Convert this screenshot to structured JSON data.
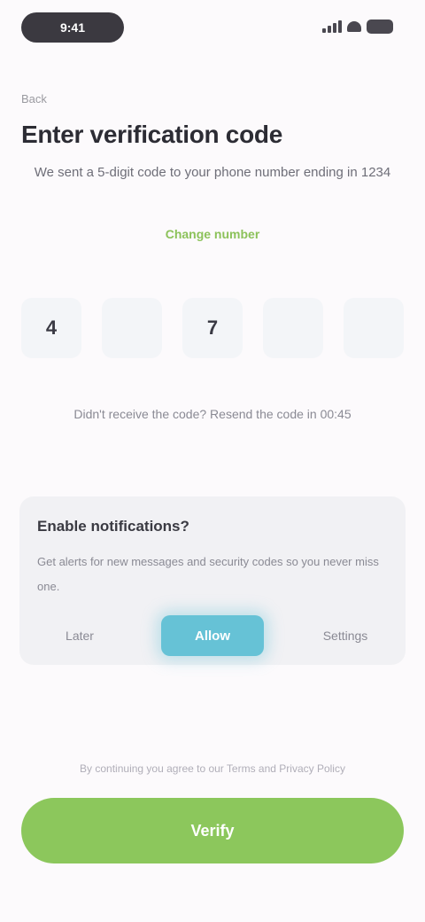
{
  "status": {
    "time": "9:41"
  },
  "header": {
    "back_label": "Back",
    "title": "Enter verification code",
    "subtitle": "We sent a 5-digit code to your phone number ending in 1234",
    "change_link": "Change number"
  },
  "code": {
    "digits": [
      "4",
      "",
      "7",
      "",
      ""
    ]
  },
  "resend": {
    "text": "Didn't receive the code? Resend the code in 00:45"
  },
  "card": {
    "title": "Enable notifications?",
    "text": "Get alerts for new messages and security codes so you never miss one.",
    "dismiss_label": "Later",
    "confirm_label": "Allow",
    "secondary_label": "Settings"
  },
  "footer": {
    "terms": "By continuing you agree to our Terms and Privacy Policy",
    "cta_label": "Verify"
  }
}
